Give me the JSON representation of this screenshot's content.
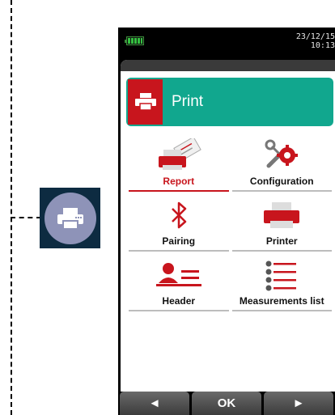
{
  "device": {
    "date": "23/12/15",
    "time": "10:13",
    "header": {
      "title": "Print",
      "icon": "printer-icon"
    },
    "menu": [
      {
        "label": "Report",
        "icon": "report-print-icon",
        "selected": true
      },
      {
        "label": "Configuration",
        "icon": "gear-wrench-icon",
        "selected": false
      },
      {
        "label": "Pairing",
        "icon": "bluetooth-icon",
        "selected": false
      },
      {
        "label": "Printer",
        "icon": "printer-icon",
        "selected": false
      },
      {
        "label": "Header",
        "icon": "user-header-icon",
        "selected": false
      },
      {
        "label": "Measurements list",
        "icon": "list-icon",
        "selected": false
      }
    ],
    "softkeys": {
      "left": "◄",
      "center": "OK",
      "right": "►"
    }
  },
  "colors": {
    "accent_red": "#c8151d",
    "header_green": "#11a78e",
    "bubble_bg": "#0d2b41",
    "bubble_circle": "#8e93b8"
  },
  "callout": {
    "icon": "printer-icon"
  }
}
